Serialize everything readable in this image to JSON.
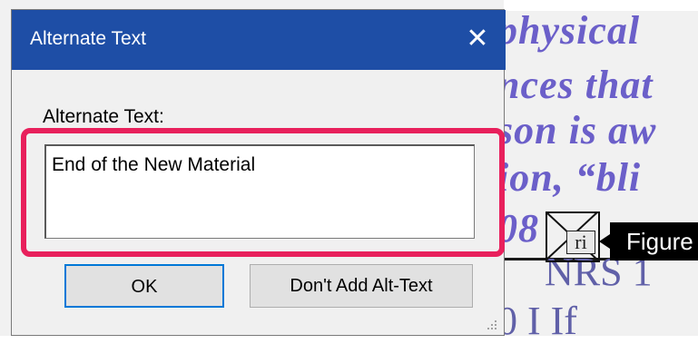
{
  "document": {
    "lines": [
      "physical",
      "nces that",
      "son is aw",
      "ion,  “bli",
      "08"
    ],
    "lower_text": "NRS 1",
    "bottom_text": "0   I   If",
    "figure_icon": "ri",
    "tooltip": "Figure"
  },
  "dialog": {
    "title": "Alternate Text",
    "close_glyph": "✕",
    "field_label": "Alternate Text:",
    "alt_text_value": "End of the New Material",
    "ok_label": "OK",
    "no_alt_label": "Don't Add Alt-Text"
  },
  "colors": {
    "titlebar": "#1e4ea6",
    "highlight": "#e8205c",
    "doc_text": "#6b5fc9"
  }
}
